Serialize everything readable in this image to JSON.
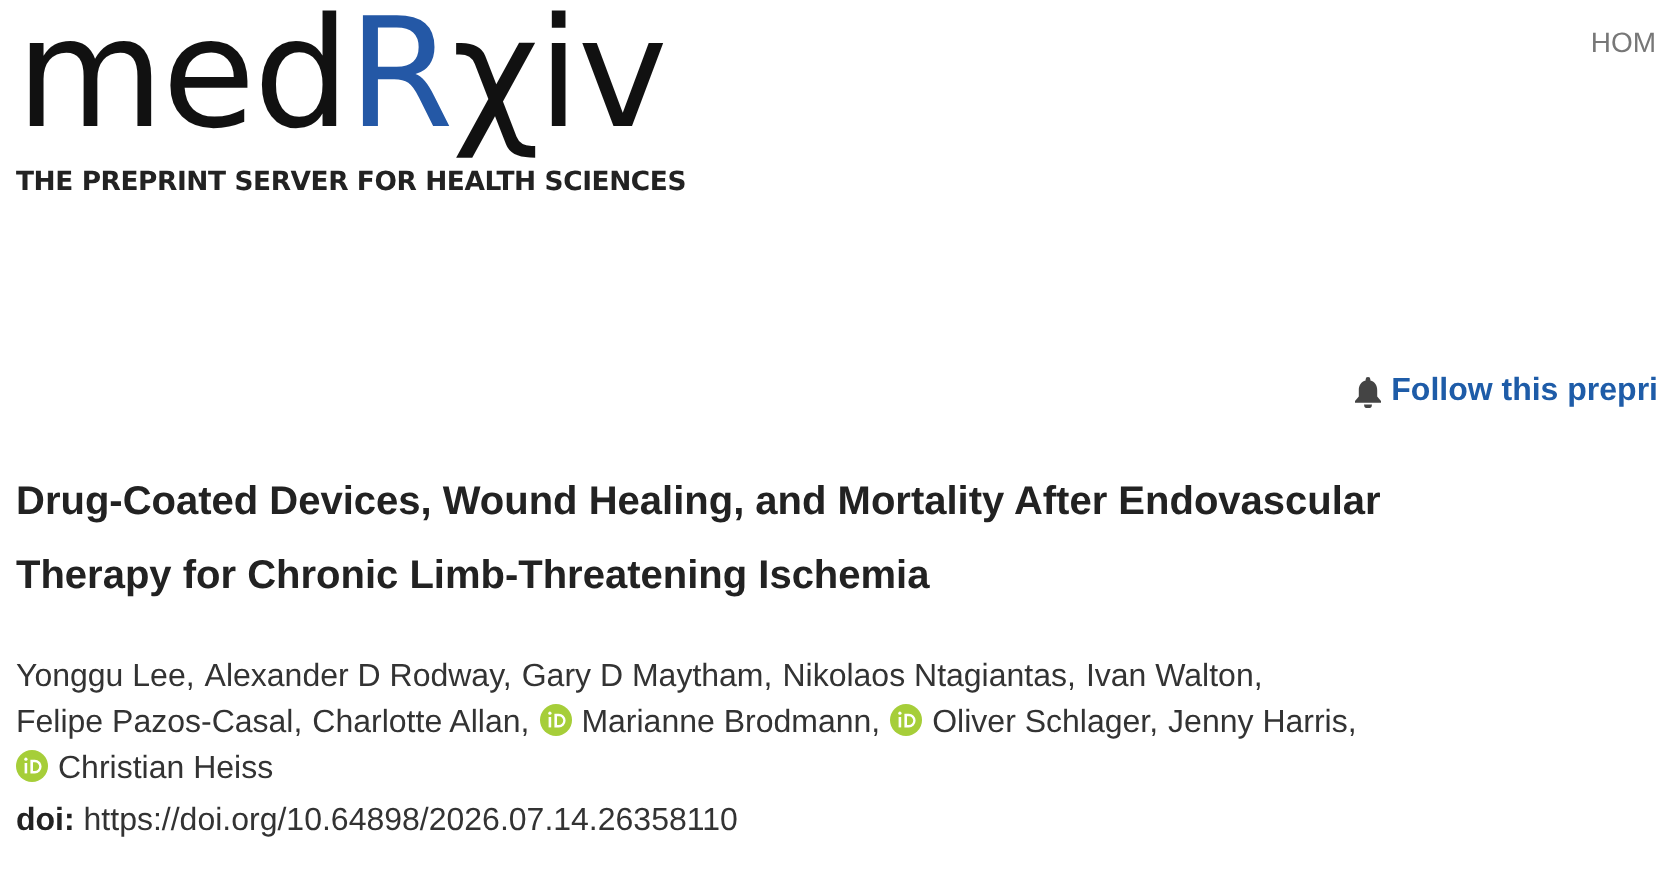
{
  "logo": {
    "prefix": "med",
    "highlight": "R",
    "suffix": "χiv",
    "tagline": "THE PREPRINT SERVER FOR HEALTH SCIENCES"
  },
  "nav": {
    "home": "HOM"
  },
  "follow": {
    "label": "Follow this prepri"
  },
  "article": {
    "title": "Drug-Coated Devices, Wound Healing, and Mortality After Endovascular Therapy for Chronic Limb-Threatening Ischemia",
    "authors": [
      {
        "name": "Yonggu Lee,",
        "orcid": false
      },
      {
        "name": "Alexander D Rodway,",
        "orcid": false
      },
      {
        "name": "Gary D Maytham,",
        "orcid": false
      },
      {
        "name": "Nikolaos Ntagiantas,",
        "orcid": false
      },
      {
        "name": "Ivan Walton,",
        "orcid": false
      },
      {
        "name": "Felipe Pazos-Casal,",
        "orcid": false
      },
      {
        "name": "Charlotte Allan,",
        "orcid": false
      },
      {
        "name": "Marianne Brodmann,",
        "orcid": true
      },
      {
        "name": "Oliver Schlager,",
        "orcid": true
      },
      {
        "name": "Jenny Harris,",
        "orcid": false
      },
      {
        "name": "Christian Heiss",
        "orcid": true
      }
    ],
    "doi_label": "doi:",
    "doi": "https://doi.org/10.64898/2026.07.14.26358110"
  }
}
